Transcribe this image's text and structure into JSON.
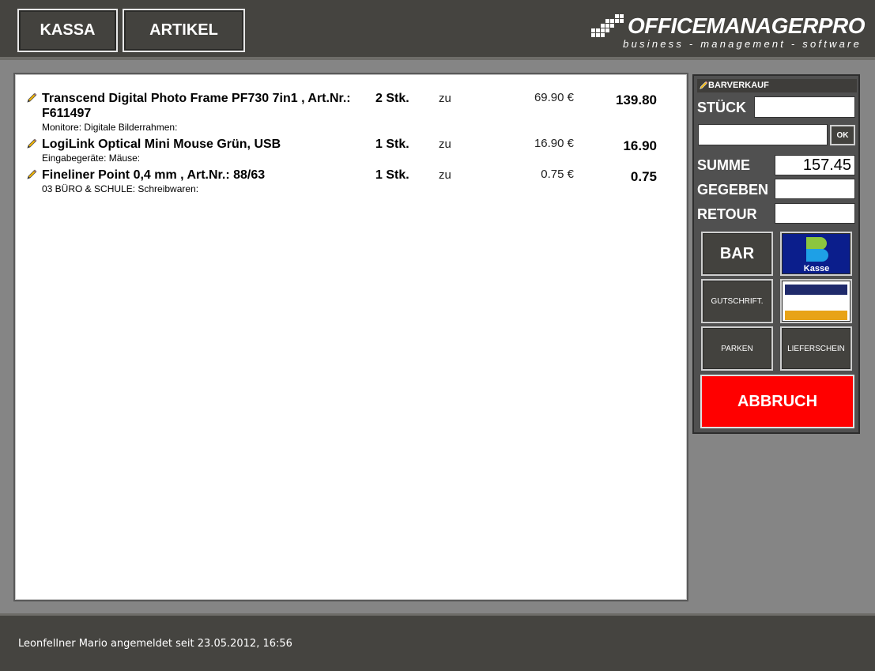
{
  "nav": {
    "kassa_label": "KASSA",
    "artikel_label": "ARTIKEL"
  },
  "logo": {
    "title": "OFFICEMANAGERPRO",
    "subtitle": "business - management - software"
  },
  "items": [
    {
      "name": "Transcend Digital Photo Frame PF730 7in1 , Art.Nr.: F611497",
      "category": "Monitore: Digitale Bilderrahmen:",
      "qty": "2 Stk.",
      "zu": "zu",
      "price": "69.90 €",
      "total": "139.80"
    },
    {
      "name": "LogiLink Optical Mini Mouse Grün, USB",
      "category": "Eingabegeräte: Mäuse:",
      "qty": "1 Stk.",
      "zu": "zu",
      "price": "16.90 €",
      "total": "16.90"
    },
    {
      "name": "Fineliner Point 0,4 mm , Art.Nr.: 88/63",
      "category": "03 BÜRO & SCHULE: Schreibwaren:",
      "qty": "1 Stk.",
      "zu": "zu",
      "price": "0.75 €",
      "total": "0.75"
    }
  ],
  "side": {
    "title": "BARVERKAUF",
    "stueck_label": "STÜCK",
    "stueck_value": "",
    "article_value": "",
    "ok_label": "OK",
    "summe_label": "SUMME",
    "summe_value": "157.45",
    "gegeben_label": "GEGEBEN",
    "gegeben_value": "",
    "retour_label": "RETOUR",
    "retour_value": "",
    "bar_label": "BAR",
    "kasse_logo_text": "Kasse",
    "gutschrift_label": "GUTSCHRIFT.",
    "parken_label": "PARKEN",
    "lieferschein_label": "LIEFERSCHEIN",
    "abbruch_label": "ABBRUCH"
  },
  "colors": {
    "abbruch": "#ff0000",
    "kasse_bg": "#0b1e8c",
    "kasse_green": "#8cc63f",
    "kasse_blue": "#1ea0e6",
    "card_navy": "#1f2a6b",
    "card_orange": "#e8a317"
  },
  "footer": {
    "status": "Leonfellner Mario angemeldet seit 23.05.2012, 16:56"
  }
}
